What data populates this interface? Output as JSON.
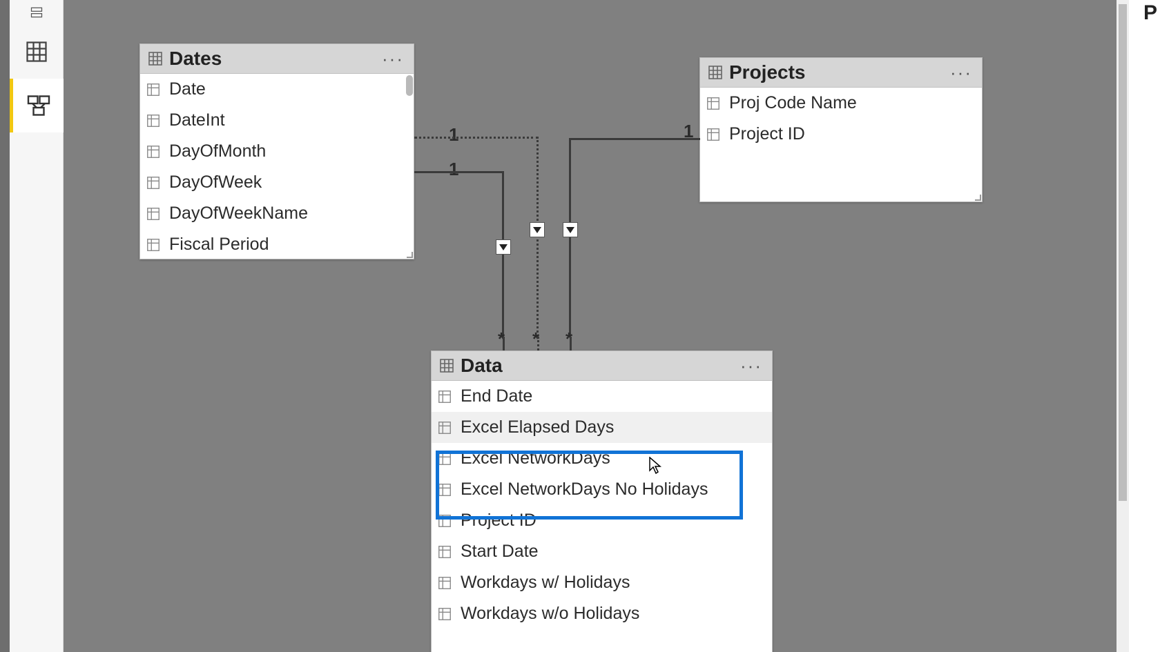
{
  "tables": {
    "dates": {
      "name": "Dates",
      "fields": [
        "Date",
        "DateInt",
        "DayOfMonth",
        "DayOfWeek",
        "DayOfWeekName",
        "Fiscal Period"
      ]
    },
    "projects": {
      "name": "Projects",
      "fields": [
        "Proj Code Name",
        "Project ID"
      ]
    },
    "data": {
      "name": "Data",
      "fields": [
        "End Date",
        "Excel Elapsed Days",
        "Excel NetworkDays",
        "Excel NetworkDays No Holidays",
        "Project ID",
        "Start Date",
        "Workdays w/ Holidays",
        "Workdays w/o Holidays"
      ]
    }
  },
  "relationships": {
    "one_label": "1",
    "many_label": "*"
  },
  "right_panel_letter": "P",
  "highlighted_fields": [
    "Excel NetworkDays",
    "Excel NetworkDays No Holidays"
  ]
}
